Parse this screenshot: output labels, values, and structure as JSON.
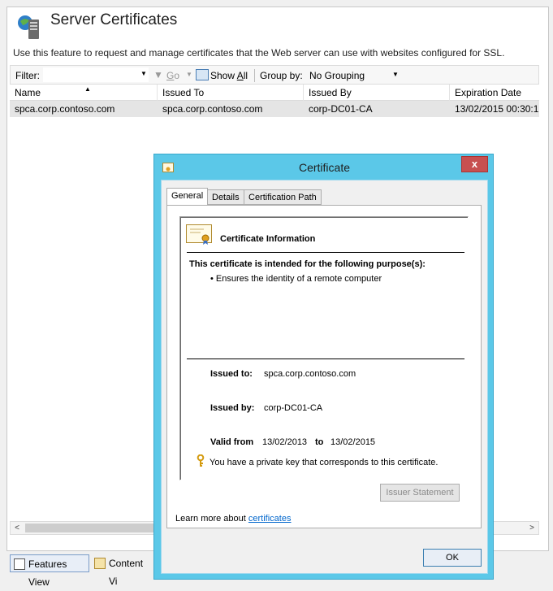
{
  "feature": {
    "title": "Server Certificates",
    "description": "Use this feature to request and manage certificates that the Web server can use with websites configured for SSL."
  },
  "filterbar": {
    "filter_label": "Filter:",
    "go_label": "Go",
    "show_all_label": "Show All",
    "group_by_label": "Group by:",
    "group_by_value": "No Grouping"
  },
  "table": {
    "columns": [
      "Name",
      "Issued To",
      "Issued By",
      "Expiration Date"
    ],
    "rows": [
      [
        "spca.corp.contoso.com",
        "spca.corp.contoso.com",
        "corp-DC01-CA",
        "13/02/2015 00:30:1"
      ]
    ]
  },
  "bottom_tabs": {
    "features_view": "Features View",
    "content_view": "Content Vi"
  },
  "dialog": {
    "title": "Certificate",
    "close_glyph": "x",
    "tabs": [
      "General",
      "Details",
      "Certification Path"
    ],
    "info_heading": "Certificate Information",
    "purpose_heading": "This certificate is intended for the following purpose(s):",
    "purposes": [
      "• Ensures the identity of a remote computer"
    ],
    "issued_to_label": "Issued to:",
    "issued_to_value": "spca.corp.contoso.com",
    "issued_by_label": "Issued by:",
    "issued_by_value": "corp-DC01-CA",
    "valid_from_label": "Valid from",
    "valid_from_value": "13/02/2013",
    "valid_to_label": "to",
    "valid_to_value": "13/02/2015",
    "private_key_text": "You have a private key that corresponds to this certificate.",
    "issuer_statement_label": "Issuer Statement",
    "learn_more_text": "Learn more about",
    "learn_more_link": "certificates",
    "ok_label": "OK"
  },
  "colors": {
    "dialog_frame": "#5bc8e8",
    "close_button": "#c75050",
    "link": "#0066cc",
    "selected_row": "#e5e5e5"
  }
}
